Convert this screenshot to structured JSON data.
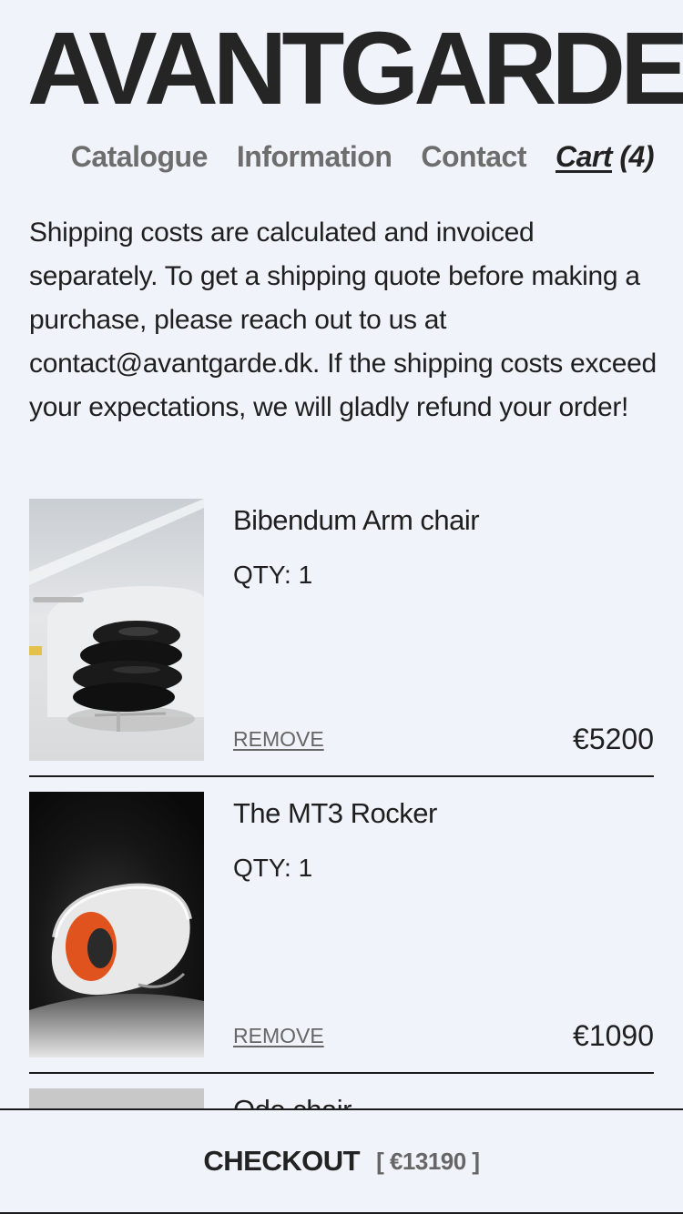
{
  "brand": {
    "logo_text": "AVANTGARDE"
  },
  "nav": {
    "catalogue": "Catalogue",
    "information": "Information",
    "contact": "Contact",
    "cart_label": "Cart",
    "cart_count": "(4)"
  },
  "notice": "Shipping costs are calculated and invoiced separately. To get a shipping quote before making a purchase, please reach out to us at contact@avantgarde.dk. If the shipping costs exceed your expectations, we will gladly refund your order!",
  "cart": {
    "items": [
      {
        "name": "Bibendum Arm chair",
        "qty": "QTY: 1",
        "remove_label": "REMOVE",
        "price": "€5200",
        "image": "black-leather-armchair-photo"
      },
      {
        "name": "The MT3 Rocker",
        "qty": "QTY: 1",
        "remove_label": "REMOVE",
        "price": "€1090",
        "image": "white-orange-rocker-chair-photo"
      },
      {
        "name": "Ode chair",
        "image": "grey-chair-photo"
      }
    ]
  },
  "checkout": {
    "label": "CHECKOUT",
    "total": "[ €13190 ]"
  },
  "colors": {
    "background": "#f0f3f9",
    "text": "#1c1c1c",
    "muted": "#6d6d6d",
    "rule": "#1a1a1a"
  }
}
